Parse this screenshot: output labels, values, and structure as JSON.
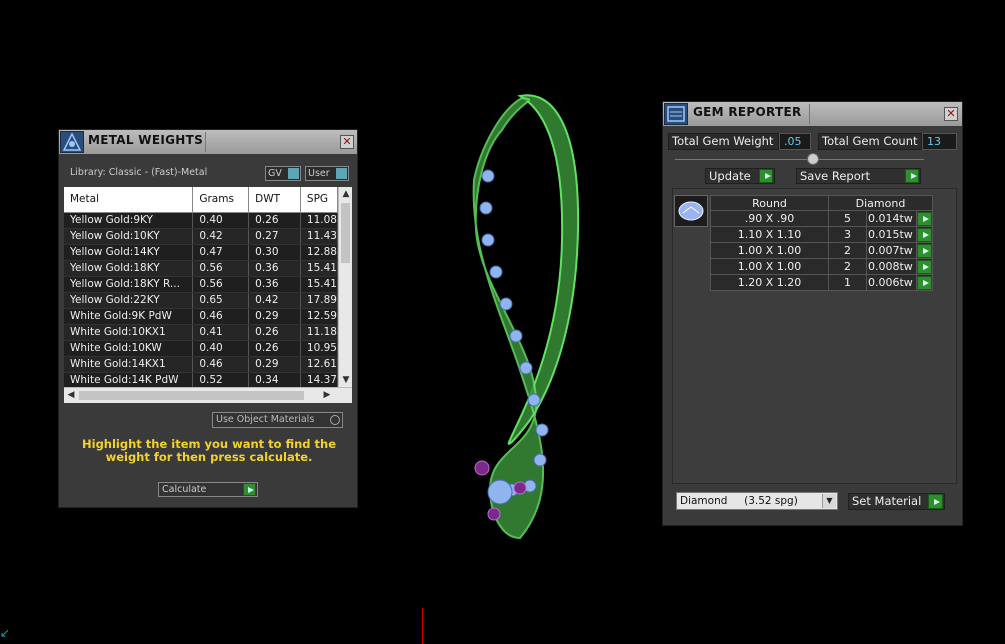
{
  "metal_weights": {
    "title": "METAL WEIGHTS",
    "library": "Library: Classic - (Fast)-Metal",
    "gv_label": "GV",
    "user_label": "User",
    "columns": [
      "Metal",
      "Grams",
      "DWT",
      "SPG"
    ],
    "rows": [
      [
        "Yellow Gold:9KY",
        "0.40",
        "0.26",
        "11.08"
      ],
      [
        "Yellow Gold:10KY",
        "0.42",
        "0.27",
        "11.43"
      ],
      [
        "Yellow Gold:14KY",
        "0.47",
        "0.30",
        "12.88"
      ],
      [
        "Yellow Gold:18KY",
        "0.56",
        "0.36",
        "15.41"
      ],
      [
        "Yellow Gold:18KY R...",
        "0.56",
        "0.36",
        "15.41"
      ],
      [
        "Yellow Gold:22KY",
        "0.65",
        "0.42",
        "17.89"
      ],
      [
        "White Gold:9K PdW",
        "0.46",
        "0.29",
        "12.59"
      ],
      [
        "White Gold:10KX1",
        "0.41",
        "0.26",
        "11.18"
      ],
      [
        "White Gold:10KW",
        "0.40",
        "0.26",
        "10.95"
      ],
      [
        "White Gold:14KX1",
        "0.46",
        "0.29",
        "12.61"
      ],
      [
        "White Gold:14K PdW",
        "0.52",
        "0.34",
        "14.37"
      ]
    ],
    "use_object_materials": "Use Object Materials",
    "hint": "Highlight the item you want to find the weight for then press calculate.",
    "calculate_label": "Calculate"
  },
  "gem_reporter": {
    "title": "GEM REPORTER",
    "total_weight_label": "Total Gem Weight",
    "total_weight_value": ".05",
    "total_count_label": "Total Gem Count",
    "total_count_value": "13",
    "update_label": "Update",
    "save_report_label": "Save Report",
    "shape_header": "Round",
    "material_header": "Diamond",
    "rows": [
      {
        "size": ".90 X .90",
        "count": "5",
        "weight": "0.014tw"
      },
      {
        "size": "1.10 X 1.10",
        "count": "3",
        "weight": "0.015tw"
      },
      {
        "size": "1.00 X 1.00",
        "count": "2",
        "weight": "0.007tw"
      },
      {
        "size": "1.00 X 1.00",
        "count": "2",
        "weight": "0.008tw"
      },
      {
        "size": "1.20 X 1.20",
        "count": "1",
        "weight": "0.006tw"
      }
    ],
    "material_select": "Diamond     (3.52 spg)",
    "set_material_label": "Set Material"
  },
  "colors": {
    "hint_text": "#f2d22c",
    "value_text": "#6cc8e8",
    "model_metal": "#63e063",
    "model_gems": "#8fb4ee",
    "accent_green": "#2f8f2f"
  }
}
